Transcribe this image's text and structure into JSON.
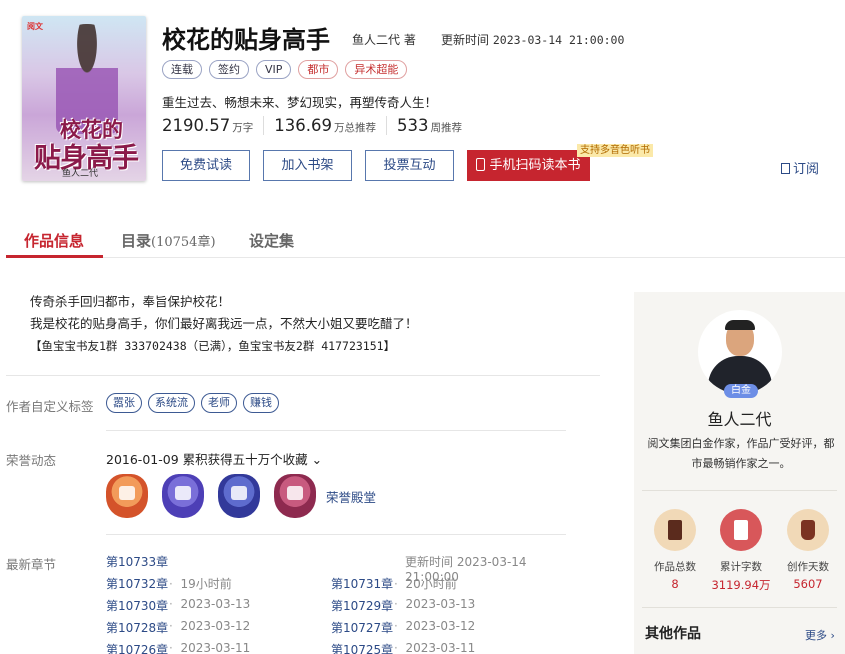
{
  "book": {
    "cover": {
      "brand": "阅文",
      "title_line1": "校花的",
      "title_line2": "贴身高手",
      "author": "鱼人二代"
    },
    "title": "校花的贴身高手",
    "author_text": "鱼人二代 著",
    "update_label": "更新时间",
    "update_time": "2023-03-14 21:00:00",
    "tags": [
      "连载",
      "签约",
      "VIP",
      "都市",
      "异术超能"
    ],
    "intro": "重生过去、畅想未来、梦幻现实，再塑传奇人生！",
    "stats": [
      {
        "num": "2190.57",
        "unit": "万字"
      },
      {
        "num": "136.69",
        "unit": "万总推荐"
      },
      {
        "num": "533",
        "unit": "周推荐"
      }
    ]
  },
  "actions": {
    "free_read": "免费试读",
    "add_shelf": "加入书架",
    "vote": "投票互动",
    "scan_read": "手机扫码读本书",
    "promo": "支持多音色听书",
    "subscribe": "订阅"
  },
  "tabs": {
    "info": "作品信息",
    "catalog": "目录",
    "catalog_count": "(10754章)",
    "settings": "设定集"
  },
  "description": {
    "line1": "传奇杀手回归都市，奉旨保护校花！",
    "line2": "我是校花的贴身高手，你们最好离我远一点，不然大小姐又要吃醋了！",
    "line3": "【鱼宝宝书友1群 333702438（已满），鱼宝宝书友2群 417723151】"
  },
  "custom_tags": {
    "label": "作者自定义标签",
    "items": [
      "嚣张",
      "系统流",
      "老师",
      "赚钱"
    ]
  },
  "honor": {
    "label": "荣誉动态",
    "line": "2016-01-09 累积获得五十万个收藏 ⌄",
    "hall": "荣誉殿堂"
  },
  "latest": {
    "label": "最新章节",
    "first": "第10733章",
    "update": "更新时间 2023-03-14 21:00:00",
    "rows": [
      [
        {
          "ch": "第10732章",
          "t": "19小时前"
        },
        {
          "ch": "第10731章",
          "t": "20小时前"
        }
      ],
      [
        {
          "ch": "第10730章",
          "t": "2023-03-13"
        },
        {
          "ch": "第10729章",
          "t": "2023-03-13"
        }
      ],
      [
        {
          "ch": "第10728章",
          "t": "2023-03-12"
        },
        {
          "ch": "第10727章",
          "t": "2023-03-12"
        }
      ],
      [
        {
          "ch": "第10726章",
          "t": "2023-03-11"
        },
        {
          "ch": "第10725章",
          "t": "2023-03-11"
        }
      ]
    ]
  },
  "author_card": {
    "level": "白金",
    "name": "鱼人二代",
    "bio": "阅文集团白金作家，作品广受好评，都市最畅销作家之一。",
    "stats": [
      {
        "label": "作品总数",
        "value": "8",
        "icon": "book-icon"
      },
      {
        "label": "累计字数",
        "value": "3119.94万",
        "icon": "document-icon"
      },
      {
        "label": "创作天数",
        "value": "5607",
        "icon": "cup-icon"
      }
    ],
    "other_works": "其他作品",
    "more": "更多 ›"
  }
}
